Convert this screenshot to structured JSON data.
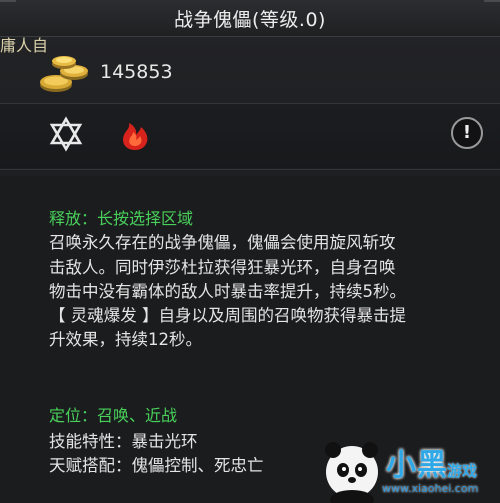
{
  "header": {
    "title": "战争傀儡(等级.0)"
  },
  "owner_tab": {
    "label": "庸人自"
  },
  "currency": {
    "icon": "gold-coins-icon",
    "amount": "145853"
  },
  "skill_icons": [
    {
      "name": "star-of-david-icon"
    },
    {
      "name": "red-flame-icon"
    }
  ],
  "info_button": {
    "label": "!"
  },
  "release": {
    "heading": "释放：长按选择区域",
    "lines": [
      "召唤永久存在的战争傀儡，傀儡会使用旋风斩攻",
      "击敌人。同时伊莎杜拉获得狂暴光环，自身召唤",
      "物击中没有霸体的敌人时暴击率提升，持续5秒。",
      "【 灵魂爆发 】自身以及周围的召唤物获得暴击提",
      "升效果，持续12秒。"
    ]
  },
  "positioning": {
    "heading": "定位：召唤、近战",
    "trait": "技能特性：暴击光环",
    "talent": "天赋搭配：傀儡控制、死忠亡"
  },
  "watermark": {
    "brand": "小黑",
    "sub": "游戏",
    "url": "www.xiaohei.com"
  },
  "colors": {
    "accent_green": "#48d05a",
    "text": "#e4e4e4",
    "background": "#1b1c1e"
  }
}
